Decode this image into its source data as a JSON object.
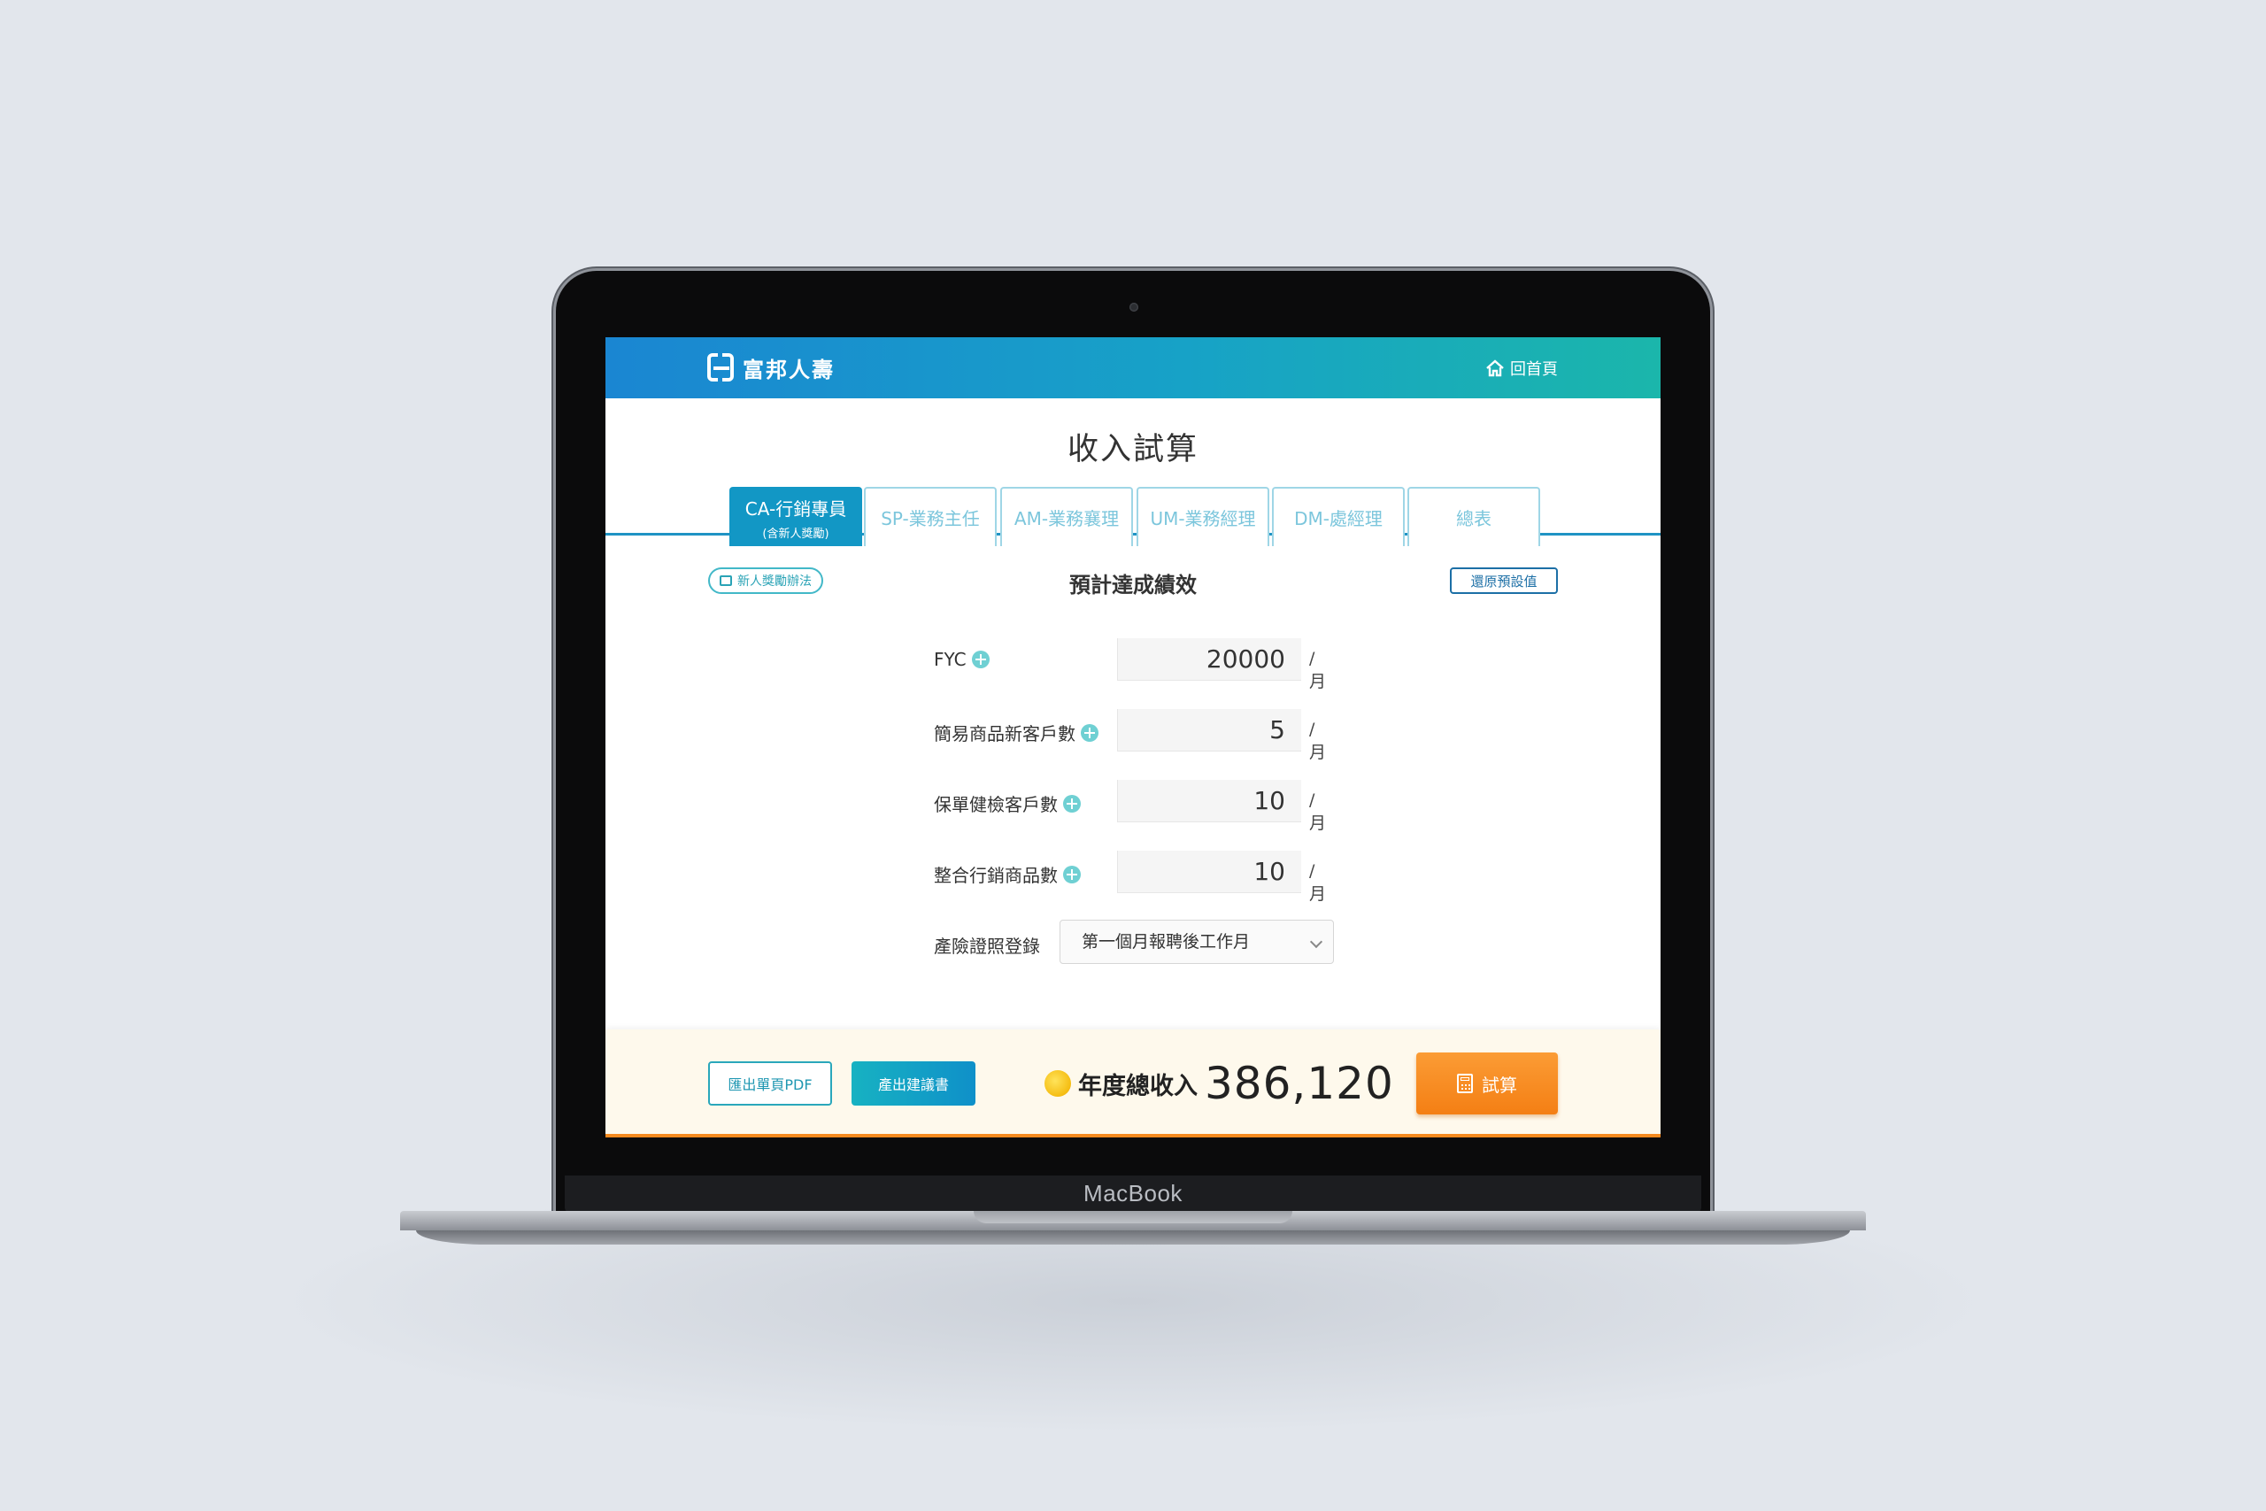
{
  "device": {
    "brand": "MacBook"
  },
  "header": {
    "logo_text": "富邦人壽",
    "home_label": "回首頁",
    "home_icon": "home-icon",
    "accent_colors": [
      "#1a86d2",
      "#1bb6ab"
    ]
  },
  "page": {
    "title": "收入試算"
  },
  "tabs": [
    {
      "label": "CA-行銷專員",
      "sub": "(含新人獎勵)",
      "active": true
    },
    {
      "label": "SP-業務主任",
      "sub": ""
    },
    {
      "label": "AM-業務襄理",
      "sub": ""
    },
    {
      "label": "UM-業務經理",
      "sub": ""
    },
    {
      "label": "DM-處經理",
      "sub": ""
    },
    {
      "label": "總表",
      "sub": ""
    }
  ],
  "section": {
    "incentive_label": "新人獎勵辦法",
    "title": "預計達成績效",
    "reset_label": "還原預設值"
  },
  "form": {
    "rows": [
      {
        "label": "FYC",
        "value": "20000",
        "unit": "/月"
      },
      {
        "label": "簡易商品新客戶數",
        "value": "5",
        "unit": "/月"
      },
      {
        "label": "保單健檢客戶數",
        "value": "10",
        "unit": "/月"
      },
      {
        "label": "整合行銷商品數",
        "value": "10",
        "unit": "/月"
      }
    ],
    "select": {
      "label": "產險證照登錄",
      "value": "第一個月報聘後工作月"
    }
  },
  "footer": {
    "pdf_label": "匯出單頁PDF",
    "proposal_label": "產出建議書",
    "total_label": "年度總收入",
    "total_value": "386,120",
    "calc_label": "試算",
    "accent_color": "#f58a1f"
  }
}
